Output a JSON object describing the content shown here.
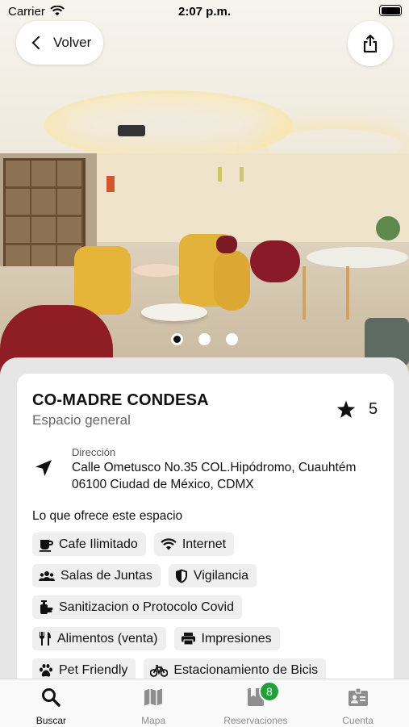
{
  "status_bar": {
    "carrier": "Carrier",
    "time": "2:07 p.m."
  },
  "nav": {
    "back_label": "Volver"
  },
  "gallery": {
    "total_photos": 3,
    "active_index": 0
  },
  "space": {
    "name": "CO-MADRE CONDESA",
    "type": "Espacio general",
    "rating": "5",
    "address_label": "Dirección",
    "address_line1": "Calle Ometusco No.35 COL.Hipódromo, Cuauhtém",
    "address_line2": "06100 Ciudad de México, CDMX"
  },
  "amenities": {
    "title": "Lo que ofrece este espacio",
    "items": [
      {
        "label": "Cafe Ilimitado",
        "icon": "coffee-icon"
      },
      {
        "label": "Internet",
        "icon": "wifi-icon"
      },
      {
        "label": "Salas de Juntas",
        "icon": "group-icon"
      },
      {
        "label": "Vigilancia",
        "icon": "shield-icon"
      },
      {
        "label": "Sanitizacion o Protocolo Covid",
        "icon": "sanitizer-icon"
      },
      {
        "label": "Alimentos (venta)",
        "icon": "utensils-icon"
      },
      {
        "label": "Impresiones",
        "icon": "printer-icon"
      },
      {
        "label": "Pet Friendly",
        "icon": "paw-icon"
      },
      {
        "label": "Estacionamiento de Bicis",
        "icon": "bike-icon"
      }
    ]
  },
  "tabs": [
    {
      "label": "Buscar",
      "icon": "search-icon",
      "active": true
    },
    {
      "label": "Mapa",
      "icon": "map-icon",
      "active": false
    },
    {
      "label": "Reservaciones",
      "icon": "book-icon",
      "active": false,
      "badge": "8"
    },
    {
      "label": "Cuenta",
      "icon": "id-card-icon",
      "active": false
    }
  ],
  "colors": {
    "badge": "#21a038",
    "tab_inactive": "#8e8e8e",
    "chip_bg": "#efefef"
  }
}
